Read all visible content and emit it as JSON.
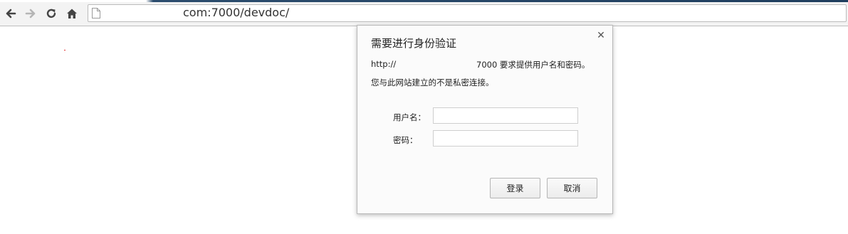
{
  "browser": {
    "url_visible": "com:7000/devdoc/",
    "icons": {
      "back": "arrow-left-icon",
      "forward": "arrow-right-icon",
      "reload": "reload-icon",
      "home": "home-icon",
      "page": "page-icon"
    }
  },
  "auth_dialog": {
    "title": "需要进行身份验证",
    "message_prefix": "http://",
    "message_suffix": "7000 要求提供用户名和密码。",
    "message_line2": "您与此网站建立的不是私密连接。",
    "username_label": "用户名：",
    "username_value": "",
    "password_label": "密码：",
    "password_value": "",
    "login_button": "登录",
    "cancel_button": "取消",
    "close_icon": "close-icon"
  }
}
